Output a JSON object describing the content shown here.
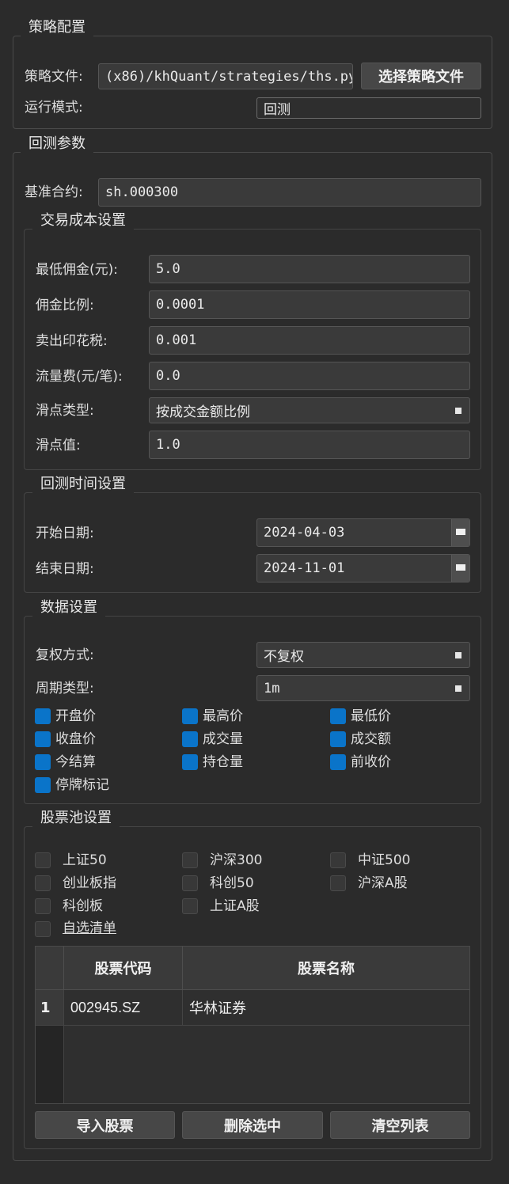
{
  "strategy_config": {
    "title": "策略配置",
    "file_label": "策略文件:",
    "file_value": "(x86)/khQuant/strategies/ths.py",
    "choose_button": "选择策略文件",
    "mode_label": "运行模式:",
    "mode_value": "回测"
  },
  "backtest_params": {
    "title": "回测参数",
    "benchmark_label": "基准合约:",
    "benchmark_value": "sh.000300"
  },
  "trade_cost": {
    "title": "交易成本设置",
    "min_commission_label": "最低佣金(元):",
    "min_commission_value": "5.0",
    "commission_rate_label": "佣金比例:",
    "commission_rate_value": "0.0001",
    "stamp_tax_label": "卖出印花税:",
    "stamp_tax_value": "0.001",
    "flow_fee_label": "流量费(元/笔):",
    "flow_fee_value": "0.0",
    "slippage_type_label": "滑点类型:",
    "slippage_type_value": "按成交金额比例",
    "slippage_value_label": "滑点值:",
    "slippage_value": "1.0"
  },
  "backtest_time": {
    "title": "回测时间设置",
    "start_label": "开始日期:",
    "start_value": "2024-04-03",
    "end_label": "结束日期:",
    "end_value": "2024-11-01"
  },
  "data_settings": {
    "title": "数据设置",
    "adjust_label": "复权方式:",
    "adjust_value": "不复权",
    "period_label": "周期类型:",
    "period_value": "1m",
    "fields": [
      {
        "label": "开盘价",
        "checked": true
      },
      {
        "label": "最高价",
        "checked": true
      },
      {
        "label": "最低价",
        "checked": true
      },
      {
        "label": "收盘价",
        "checked": true
      },
      {
        "label": "成交量",
        "checked": true
      },
      {
        "label": "成交额",
        "checked": true
      },
      {
        "label": "今结算",
        "checked": true
      },
      {
        "label": "持仓量",
        "checked": true
      },
      {
        "label": "前收价",
        "checked": true
      },
      {
        "label": "停牌标记",
        "checked": true
      }
    ]
  },
  "stock_pool": {
    "title": "股票池设置",
    "options": [
      {
        "label": "上证50",
        "checked": false
      },
      {
        "label": "沪深300",
        "checked": false
      },
      {
        "label": "中证500",
        "checked": false
      },
      {
        "label": "创业板指",
        "checked": false
      },
      {
        "label": "科创50",
        "checked": false
      },
      {
        "label": "沪深A股",
        "checked": false
      },
      {
        "label": "科创板",
        "checked": false
      },
      {
        "label": "上证A股",
        "checked": false
      },
      {
        "label": "自选清单",
        "checked": false
      }
    ],
    "table": {
      "headers": [
        "股票代码",
        "股票名称"
      ],
      "rows": [
        {
          "index": "1",
          "code": "002945.SZ",
          "name": "华林证券"
        }
      ]
    },
    "buttons": {
      "import": "导入股票",
      "delete": "删除选中",
      "clear": "清空列表"
    }
  },
  "colors": {
    "background": "#2b2b2b",
    "accent_checkbox": "#0a74c9"
  }
}
